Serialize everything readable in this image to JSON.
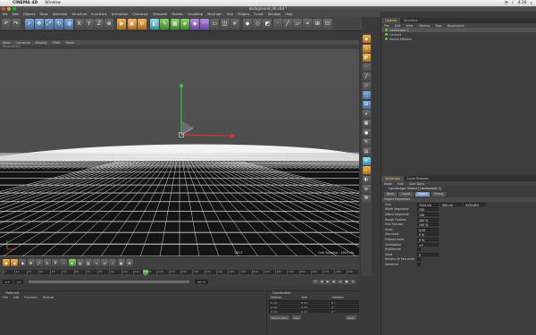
{
  "menubar": {
    "app": "CINEMA 4D",
    "window": "Window",
    "clock": "4:30"
  },
  "window_title": "background_00.c4d *",
  "app_menu": [
    "File",
    "Edit",
    "Objects",
    "Tools",
    "Selection",
    "Structure",
    "Functions",
    "Animation",
    "Character",
    "Simulate",
    "Render",
    "Sculpting",
    "MoGraph",
    "Hair",
    "Plugins",
    "Script",
    "Window",
    "Help"
  ],
  "viewport": {
    "menu": [
      "View",
      "Cameras",
      "Display",
      "Filter",
      "Panel"
    ],
    "title": "Perspective",
    "scale_label": "Grid Spacing : 1000 cm",
    "fps_label": "163 F"
  },
  "object_manager": {
    "tabs": [
      "Objects",
      "Structure"
    ],
    "menu": [
      "File",
      "Edit",
      "View",
      "Objects",
      "Tags",
      "Bookmarks"
    ],
    "objects": [
      "Landscape.1",
      "Camera",
      "Sound Effector"
    ]
  },
  "attribute_manager": {
    "tabs": [
      "Attributes",
      "Layer Browser"
    ],
    "menu": [
      "Mode",
      "Edit",
      "User Data"
    ],
    "object_title": "Landscape Object [Landscape.1]",
    "subtabs": [
      "Basic",
      "Coord.",
      "Object",
      "Phong"
    ],
    "active_subtab": "Object",
    "section": "Object Properties",
    "props": [
      {
        "label": "Size",
        "v1": "7124 cm",
        "v2": "900 cm",
        "v3": "5135.602"
      },
      {
        "label": "Width Segments",
        "v1": "150"
      },
      {
        "label": "Depth Segments",
        "v1": "150"
      },
      {
        "label": "Rough Furrows",
        "v1": "100 %"
      },
      {
        "label": "Fine Furrows",
        "v1": "100 %"
      },
      {
        "label": "Scale",
        "v1": "4.05"
      },
      {
        "label": "Sea Level",
        "v1": "0 %"
      },
      {
        "label": "Plateau Level",
        "v1": "0 %"
      },
      {
        "label": "Orientation",
        "v1": "+Y"
      },
      {
        "label": "Multifractal",
        "v1": ""
      },
      {
        "label": "Seed",
        "v1": "0"
      },
      {
        "label": "Borders At Sea Level",
        "v1": ""
      },
      {
        "label": "Spherical",
        "v1": ""
      }
    ]
  },
  "timeline": {
    "ticks": [
      "0",
      "10",
      "20",
      "30",
      "40",
      "50",
      "60",
      "70",
      "80",
      "90",
      "100",
      "110",
      "120",
      "130",
      "140",
      "150",
      "160",
      "170",
      "180",
      "190",
      "200",
      "210",
      "220",
      "230",
      "240",
      "250",
      "260",
      "270",
      "280",
      "290"
    ],
    "playhead": "157 F",
    "start": "0 F",
    "end": "307 F",
    "current": "0 F"
  },
  "materials": {
    "title": "Materials",
    "menu": [
      "File",
      "Edit",
      "Function",
      "Texture"
    ]
  },
  "coordinates": {
    "title": "Coordinates",
    "cols": [
      "Position",
      "Size",
      "Rotation"
    ],
    "rows": [
      [
        "0 cm",
        "0 cm",
        "0 °"
      ],
      [
        "0 cm",
        "0 cm",
        "0 °"
      ],
      [
        "0 cm",
        "0 cm",
        "0 °"
      ]
    ],
    "mode1": "Object (Rel)",
    "mode2": "Size",
    "apply": "Apply"
  }
}
